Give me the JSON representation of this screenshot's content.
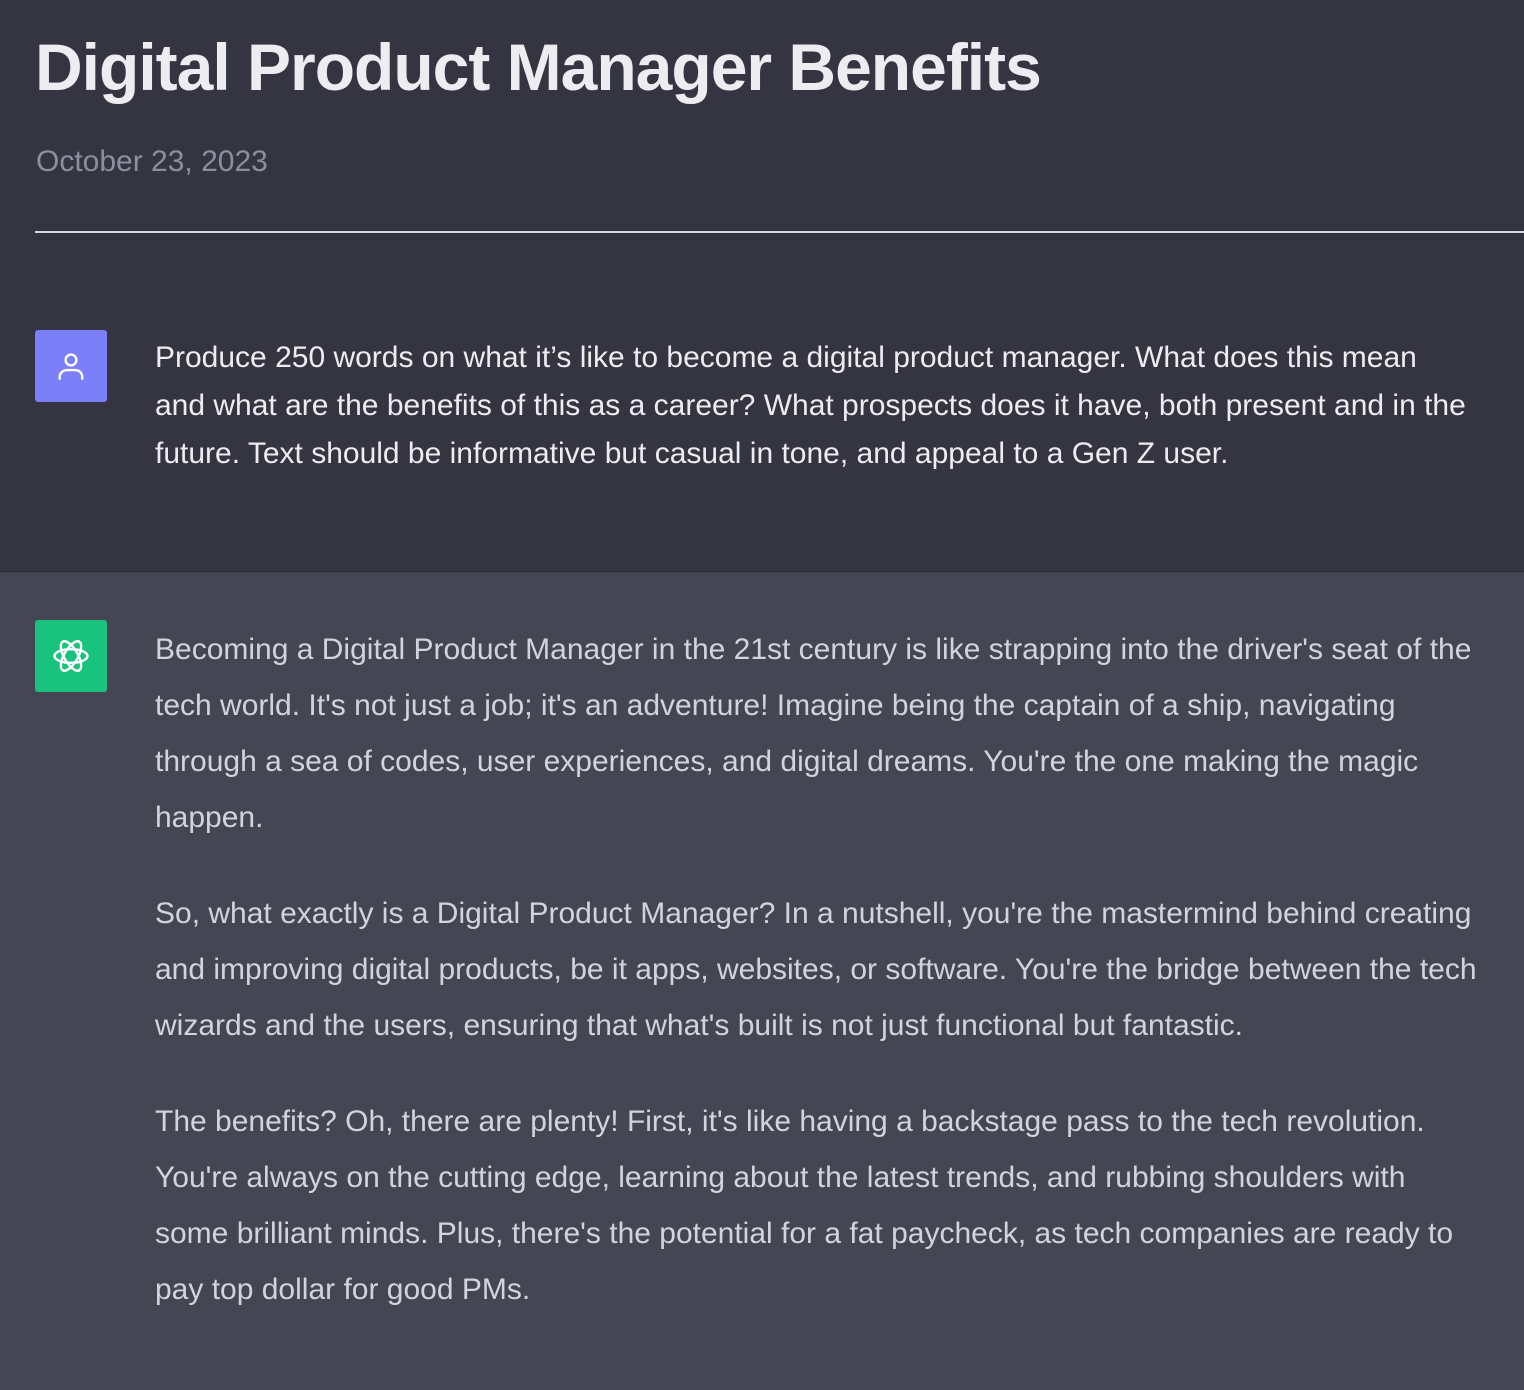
{
  "header": {
    "title": "Digital Product Manager Benefits",
    "date": "October 23, 2023"
  },
  "user_message": {
    "avatar_icon": "user-icon",
    "text": "Produce 250 words on what it’s like to become a digital product manager. What does this mean and what are the benefits of this as a career? What prospects does it have, both present and in the future. Text should be informative but casual in tone, and appeal to a Gen Z user."
  },
  "assistant_message": {
    "avatar_icon": "openai-logo-icon",
    "paragraphs": [
      "Becoming a Digital Product Manager in the 21st century is like strapping into the driver's seat of the tech world. It's not just a job; it's an adventure! Imagine being the captain of a ship, navigating through a sea of codes, user experiences, and digital dreams. You're the one making the magic happen.",
      "So, what exactly is a Digital Product Manager? In a nutshell, you're the mastermind behind creating and improving digital products, be it apps, websites, or software. You're the bridge between the tech wizards and the users, ensuring that what's built is not just functional but fantastic.",
      "The benefits? Oh, there are plenty! First, it's like having a backstage pass to the tech revolution. You're always on the cutting edge, learning about the latest trends, and rubbing shoulders with some brilliant minds. Plus, there's the potential for a fat paycheck, as tech companies are ready to pay top dollar for good PMs."
    ]
  },
  "colors": {
    "user_avatar_bg": "#7b7ff9",
    "assistant_avatar_bg": "#19c37d",
    "page_bg": "#343541",
    "assistant_bg": "#444654"
  }
}
